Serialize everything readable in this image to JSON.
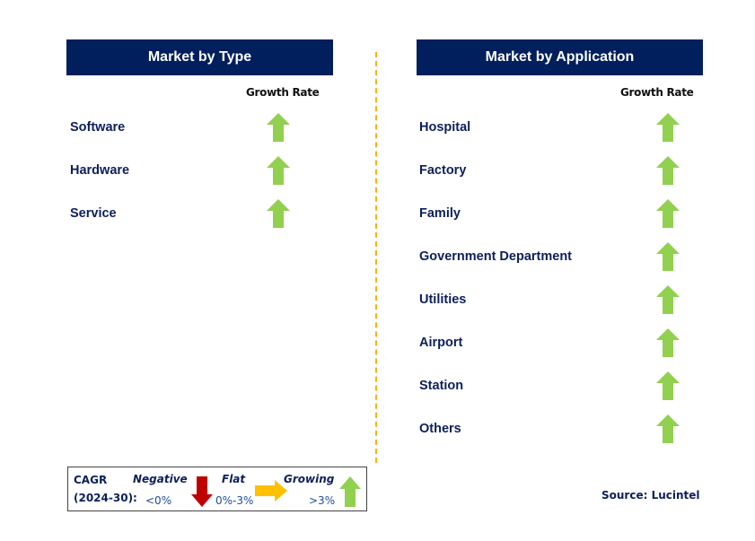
{
  "left_panel": {
    "title": "Market by Type",
    "column_header": "Growth Rate",
    "rows": [
      {
        "label": "Software",
        "trend": "growing"
      },
      {
        "label": "Hardware",
        "trend": "growing"
      },
      {
        "label": "Service",
        "trend": "growing"
      }
    ]
  },
  "right_panel": {
    "title": "Market by Application",
    "column_header": "Growth Rate",
    "rows": [
      {
        "label": "Hospital",
        "trend": "growing"
      },
      {
        "label": "Factory",
        "trend": "growing"
      },
      {
        "label": "Family",
        "trend": "growing"
      },
      {
        "label": "Government Department",
        "trend": "growing"
      },
      {
        "label": "Utilities",
        "trend": "growing"
      },
      {
        "label": "Airport",
        "trend": "growing"
      },
      {
        "label": "Station",
        "trend": "growing"
      },
      {
        "label": "Others",
        "trend": "growing"
      }
    ]
  },
  "legend": {
    "cagr_label_line1": "CAGR",
    "cagr_label_line2": "(2024-30):",
    "negative": {
      "label": "Negative",
      "range": "<0%",
      "icon": "arrow-down-icon",
      "color": "#c00000"
    },
    "flat": {
      "label": "Flat",
      "range": "0%-3%",
      "icon": "arrow-right-icon",
      "color": "#ffc000"
    },
    "growing": {
      "label": "Growing",
      "range": ">3%",
      "icon": "arrow-up-icon",
      "color": "#92d050"
    }
  },
  "source": "Source: Lucintel",
  "colors": {
    "header_bg": "#001f5c",
    "label_text": "#0d1f5c",
    "divider": "#f7b500",
    "growing_arrow": "#92d050"
  }
}
